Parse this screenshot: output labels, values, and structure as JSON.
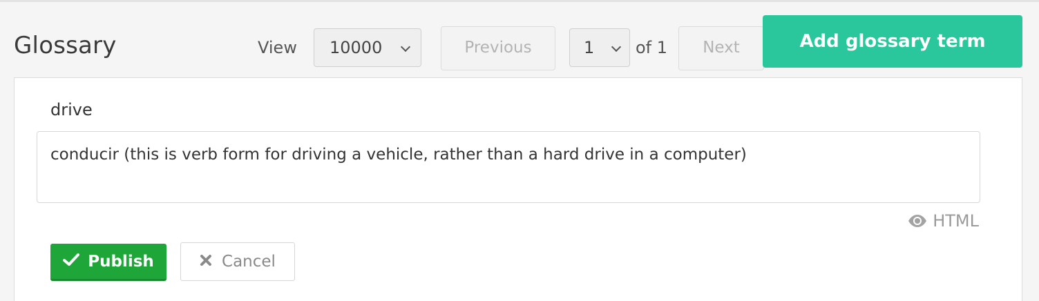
{
  "header": {
    "title": "Glossary",
    "view_label": "View",
    "view_count": "10000",
    "previous_label": "Previous",
    "page_value": "1",
    "of_label": "of 1",
    "next_label": "Next",
    "add_button_label": "Add glossary term"
  },
  "entry": {
    "term": "drive",
    "definition": "conducir (this is verb form for driving a vehicle, rather than a hard drive in a computer)",
    "html_toggle_label": "HTML",
    "publish_label": "Publish",
    "cancel_label": "Cancel"
  },
  "icons": {
    "view_chevron": "chevron-down-icon",
    "page_chevron": "chevron-down-icon",
    "eye": "eye-icon",
    "check": "check-icon",
    "close": "close-icon"
  },
  "colors": {
    "accent": "#2ac79d",
    "publish": "#1ea639",
    "disabled_text": "#b3b3b3"
  }
}
